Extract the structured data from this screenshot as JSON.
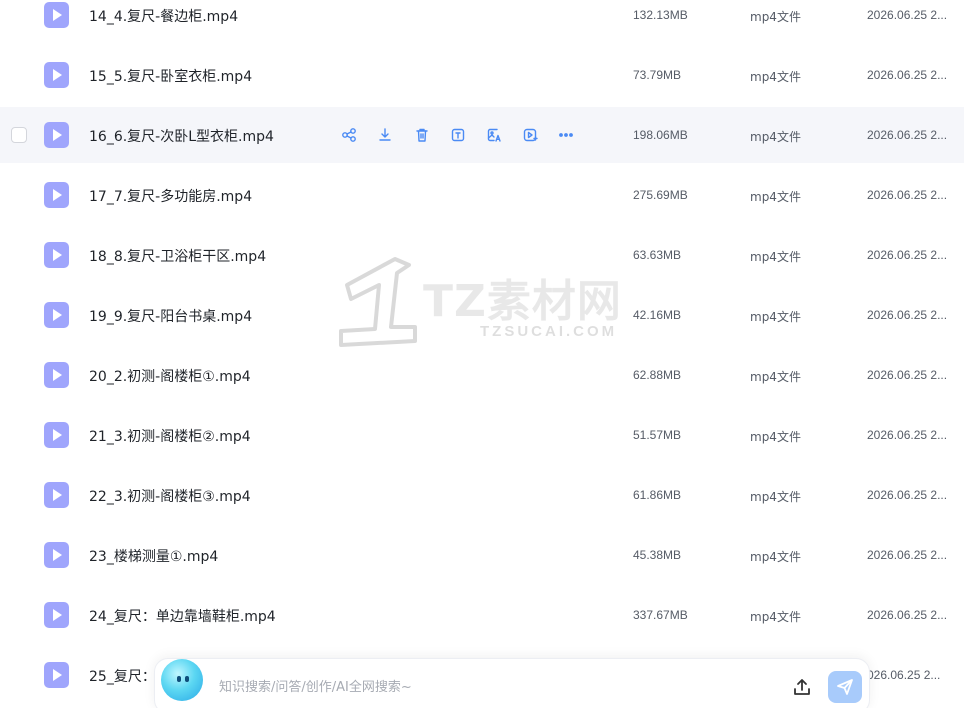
{
  "files": [
    {
      "name": "14_4.复尺-餐边柜.mp4",
      "size": "132.13MB",
      "type": "mp4文件",
      "date": "2026.06.25 2..."
    },
    {
      "name": "15_5.复尺-卧室衣柜.mp4",
      "size": "73.79MB",
      "type": "mp4文件",
      "date": "2026.06.25 2..."
    },
    {
      "name": "16_6.复尺-次卧L型衣柜.mp4",
      "size": "198.06MB",
      "type": "mp4文件",
      "date": "2026.06.25 2...",
      "hover": true
    },
    {
      "name": "17_7.复尺-多功能房.mp4",
      "size": "275.69MB",
      "type": "mp4文件",
      "date": "2026.06.25 2..."
    },
    {
      "name": "18_8.复尺-卫浴柜干区.mp4",
      "size": "63.63MB",
      "type": "mp4文件",
      "date": "2026.06.25 2..."
    },
    {
      "name": "19_9.复尺-阳台书桌.mp4",
      "size": "42.16MB",
      "type": "mp4文件",
      "date": "2026.06.25 2..."
    },
    {
      "name": "20_2.初测-阁楼柜①.mp4",
      "size": "62.88MB",
      "type": "mp4文件",
      "date": "2026.06.25 2..."
    },
    {
      "name": "21_3.初测-阁楼柜②.mp4",
      "size": "51.57MB",
      "type": "mp4文件",
      "date": "2026.06.25 2..."
    },
    {
      "name": "22_3.初测-阁楼柜③.mp4",
      "size": "61.86MB",
      "type": "mp4文件",
      "date": "2026.06.25 2..."
    },
    {
      "name": "23_楼梯测量①.mp4",
      "size": "45.38MB",
      "type": "mp4文件",
      "date": "2026.06.25 2..."
    },
    {
      "name": "24_复尺：单边靠墙鞋柜.mp4",
      "size": "337.67MB",
      "type": "mp4文件",
      "date": "2026.06.25 2..."
    },
    {
      "name": "25_复尺：",
      "size": "",
      "type": "",
      "date": "026.06.25 2..."
    }
  ],
  "row_actions": [
    "share-icon",
    "download-icon",
    "delete-icon",
    "text-extract-icon",
    "image-translate-icon",
    "video-export-icon",
    "more-icon"
  ],
  "watermark": {
    "title": "TZ素材网",
    "subtitle": "TZSUCAI.COM"
  },
  "search": {
    "placeholder": "知识搜索/问答/创作/AI全网搜索~"
  },
  "colors": {
    "accent": "#4a8af4",
    "file_icon": "#9fa5fc",
    "send_button": "#a8cbfb",
    "hover_row": "#f5f6fa"
  }
}
